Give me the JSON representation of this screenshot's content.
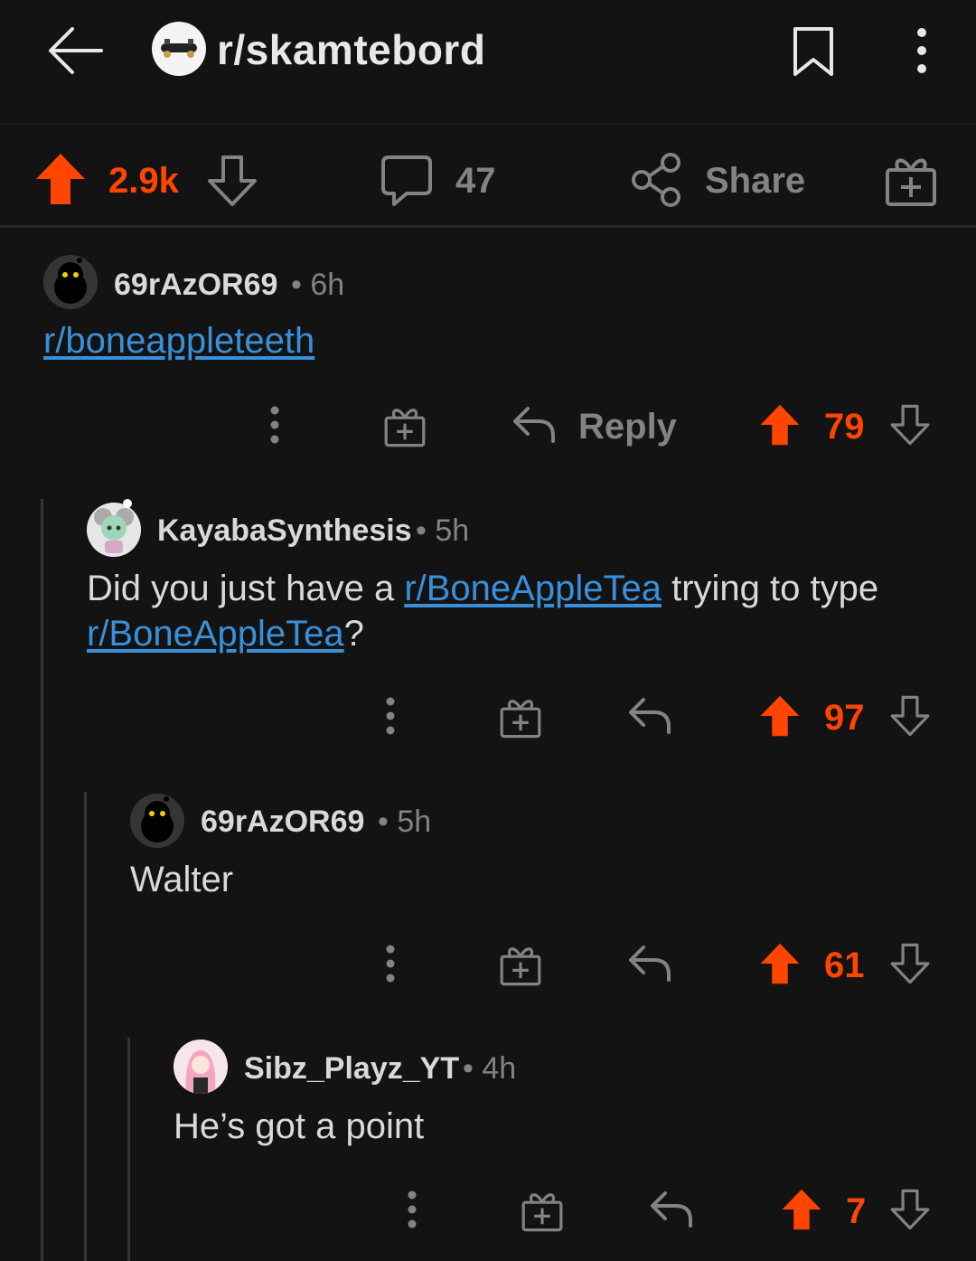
{
  "header": {
    "subreddit": "r/skamtebord",
    "icons": {
      "back": "back-arrow-icon",
      "bookmark": "bookmark-icon",
      "more": "more-vertical-icon"
    }
  },
  "post_actions": {
    "score": "2.9k",
    "comments": "47",
    "share_label": "Share",
    "icons": [
      "upvote-icon",
      "downvote-icon",
      "comment-icon",
      "share-icon",
      "award-icon"
    ]
  },
  "comments": [
    {
      "author": "69rAzOR69",
      "time": "6h",
      "body": {
        "link": "r/boneappleteeth"
      },
      "reply_label": "Reply",
      "score": "79"
    },
    {
      "author": "KayabaSynthesis",
      "time": "5h",
      "body": {
        "text1": "Did you just have a ",
        "link1": "r/BoneAppleTea",
        "text2": " trying to type ",
        "link2": "r/BoneAppleTea",
        "text3": "?"
      },
      "score": "97"
    },
    {
      "author": "69rAzOR69",
      "time": "5h",
      "body": {
        "text": "Walter"
      },
      "score": "61"
    },
    {
      "author": "Sibz_Playz_YT",
      "time": "4h",
      "body": {
        "text": "He’s got a point"
      },
      "score": "7"
    }
  ],
  "colors": {
    "background": "#131313",
    "upvote": "#ff4500",
    "link": "#3a8fd9",
    "muted": "#818384",
    "text": "#d7dadc"
  }
}
